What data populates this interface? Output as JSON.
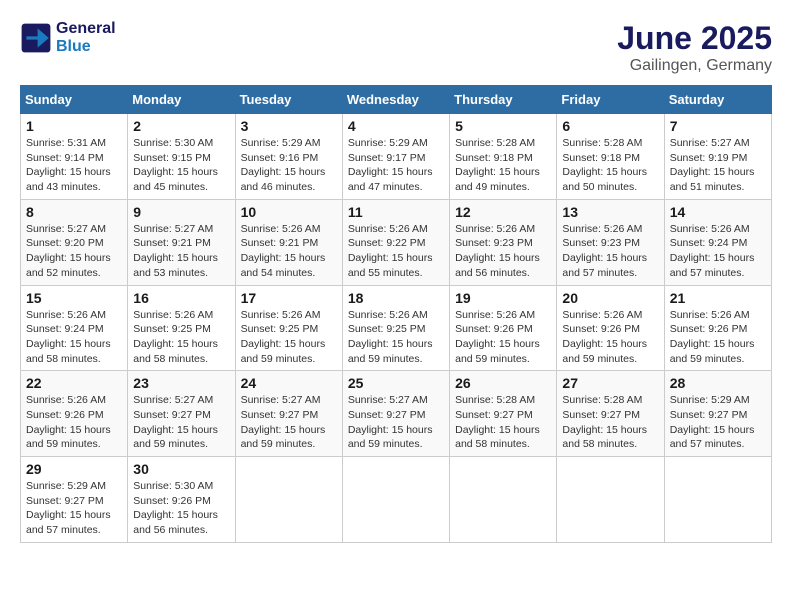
{
  "header": {
    "logo_line1": "General",
    "logo_line2": "Blue",
    "month": "June 2025",
    "location": "Gailingen, Germany"
  },
  "weekdays": [
    "Sunday",
    "Monday",
    "Tuesday",
    "Wednesday",
    "Thursday",
    "Friday",
    "Saturday"
  ],
  "weeks": [
    [
      {
        "day": "1",
        "sunrise": "Sunrise: 5:31 AM",
        "sunset": "Sunset: 9:14 PM",
        "daylight": "Daylight: 15 hours and 43 minutes."
      },
      {
        "day": "2",
        "sunrise": "Sunrise: 5:30 AM",
        "sunset": "Sunset: 9:15 PM",
        "daylight": "Daylight: 15 hours and 45 minutes."
      },
      {
        "day": "3",
        "sunrise": "Sunrise: 5:29 AM",
        "sunset": "Sunset: 9:16 PM",
        "daylight": "Daylight: 15 hours and 46 minutes."
      },
      {
        "day": "4",
        "sunrise": "Sunrise: 5:29 AM",
        "sunset": "Sunset: 9:17 PM",
        "daylight": "Daylight: 15 hours and 47 minutes."
      },
      {
        "day": "5",
        "sunrise": "Sunrise: 5:28 AM",
        "sunset": "Sunset: 9:18 PM",
        "daylight": "Daylight: 15 hours and 49 minutes."
      },
      {
        "day": "6",
        "sunrise": "Sunrise: 5:28 AM",
        "sunset": "Sunset: 9:18 PM",
        "daylight": "Daylight: 15 hours and 50 minutes."
      },
      {
        "day": "7",
        "sunrise": "Sunrise: 5:27 AM",
        "sunset": "Sunset: 9:19 PM",
        "daylight": "Daylight: 15 hours and 51 minutes."
      }
    ],
    [
      {
        "day": "8",
        "sunrise": "Sunrise: 5:27 AM",
        "sunset": "Sunset: 9:20 PM",
        "daylight": "Daylight: 15 hours and 52 minutes."
      },
      {
        "day": "9",
        "sunrise": "Sunrise: 5:27 AM",
        "sunset": "Sunset: 9:21 PM",
        "daylight": "Daylight: 15 hours and 53 minutes."
      },
      {
        "day": "10",
        "sunrise": "Sunrise: 5:26 AM",
        "sunset": "Sunset: 9:21 PM",
        "daylight": "Daylight: 15 hours and 54 minutes."
      },
      {
        "day": "11",
        "sunrise": "Sunrise: 5:26 AM",
        "sunset": "Sunset: 9:22 PM",
        "daylight": "Daylight: 15 hours and 55 minutes."
      },
      {
        "day": "12",
        "sunrise": "Sunrise: 5:26 AM",
        "sunset": "Sunset: 9:23 PM",
        "daylight": "Daylight: 15 hours and 56 minutes."
      },
      {
        "day": "13",
        "sunrise": "Sunrise: 5:26 AM",
        "sunset": "Sunset: 9:23 PM",
        "daylight": "Daylight: 15 hours and 57 minutes."
      },
      {
        "day": "14",
        "sunrise": "Sunrise: 5:26 AM",
        "sunset": "Sunset: 9:24 PM",
        "daylight": "Daylight: 15 hours and 57 minutes."
      }
    ],
    [
      {
        "day": "15",
        "sunrise": "Sunrise: 5:26 AM",
        "sunset": "Sunset: 9:24 PM",
        "daylight": "Daylight: 15 hours and 58 minutes."
      },
      {
        "day": "16",
        "sunrise": "Sunrise: 5:26 AM",
        "sunset": "Sunset: 9:25 PM",
        "daylight": "Daylight: 15 hours and 58 minutes."
      },
      {
        "day": "17",
        "sunrise": "Sunrise: 5:26 AM",
        "sunset": "Sunset: 9:25 PM",
        "daylight": "Daylight: 15 hours and 59 minutes."
      },
      {
        "day": "18",
        "sunrise": "Sunrise: 5:26 AM",
        "sunset": "Sunset: 9:25 PM",
        "daylight": "Daylight: 15 hours and 59 minutes."
      },
      {
        "day": "19",
        "sunrise": "Sunrise: 5:26 AM",
        "sunset": "Sunset: 9:26 PM",
        "daylight": "Daylight: 15 hours and 59 minutes."
      },
      {
        "day": "20",
        "sunrise": "Sunrise: 5:26 AM",
        "sunset": "Sunset: 9:26 PM",
        "daylight": "Daylight: 15 hours and 59 minutes."
      },
      {
        "day": "21",
        "sunrise": "Sunrise: 5:26 AM",
        "sunset": "Sunset: 9:26 PM",
        "daylight": "Daylight: 15 hours and 59 minutes."
      }
    ],
    [
      {
        "day": "22",
        "sunrise": "Sunrise: 5:26 AM",
        "sunset": "Sunset: 9:26 PM",
        "daylight": "Daylight: 15 hours and 59 minutes."
      },
      {
        "day": "23",
        "sunrise": "Sunrise: 5:27 AM",
        "sunset": "Sunset: 9:27 PM",
        "daylight": "Daylight: 15 hours and 59 minutes."
      },
      {
        "day": "24",
        "sunrise": "Sunrise: 5:27 AM",
        "sunset": "Sunset: 9:27 PM",
        "daylight": "Daylight: 15 hours and 59 minutes."
      },
      {
        "day": "25",
        "sunrise": "Sunrise: 5:27 AM",
        "sunset": "Sunset: 9:27 PM",
        "daylight": "Daylight: 15 hours and 59 minutes."
      },
      {
        "day": "26",
        "sunrise": "Sunrise: 5:28 AM",
        "sunset": "Sunset: 9:27 PM",
        "daylight": "Daylight: 15 hours and 58 minutes."
      },
      {
        "day": "27",
        "sunrise": "Sunrise: 5:28 AM",
        "sunset": "Sunset: 9:27 PM",
        "daylight": "Daylight: 15 hours and 58 minutes."
      },
      {
        "day": "28",
        "sunrise": "Sunrise: 5:29 AM",
        "sunset": "Sunset: 9:27 PM",
        "daylight": "Daylight: 15 hours and 57 minutes."
      }
    ],
    [
      {
        "day": "29",
        "sunrise": "Sunrise: 5:29 AM",
        "sunset": "Sunset: 9:27 PM",
        "daylight": "Daylight: 15 hours and 57 minutes."
      },
      {
        "day": "30",
        "sunrise": "Sunrise: 5:30 AM",
        "sunset": "Sunset: 9:26 PM",
        "daylight": "Daylight: 15 hours and 56 minutes."
      },
      null,
      null,
      null,
      null,
      null
    ]
  ]
}
